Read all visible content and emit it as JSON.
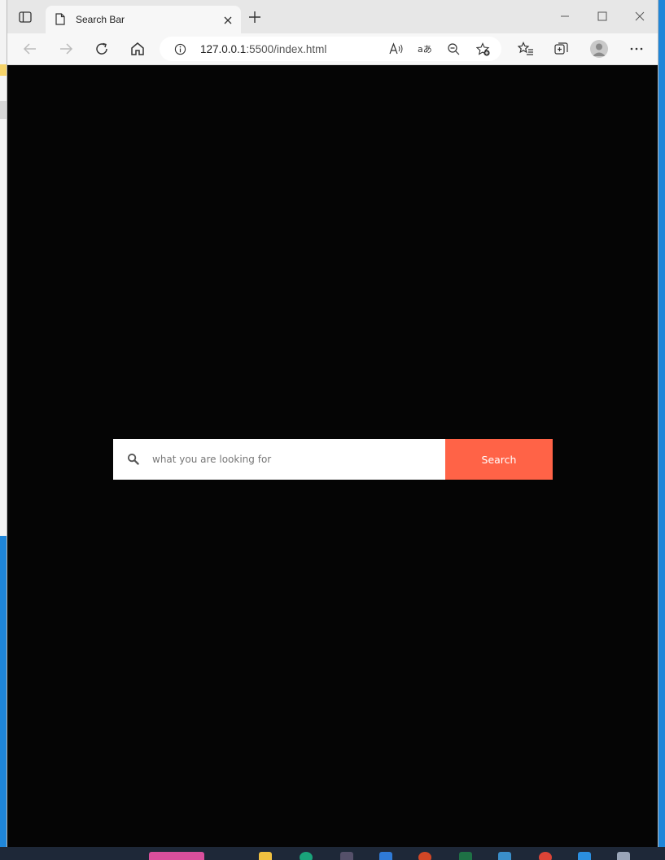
{
  "browser": {
    "tab": {
      "title": "Search Bar"
    },
    "address": {
      "host": "127.0.0.1",
      "rest": ":5500/index.html"
    }
  },
  "page": {
    "search": {
      "placeholder": "what you are looking for",
      "button_label": "Search"
    }
  },
  "colors": {
    "page_background": "#050505",
    "search_button": "#ff6347",
    "search_field": "#ffffff"
  },
  "icons": [
    "tab-actions-icon",
    "page-icon",
    "close-icon",
    "new-tab-icon",
    "minimize-icon",
    "maximize-icon",
    "window-close-icon",
    "back-icon",
    "forward-icon",
    "refresh-icon",
    "home-icon",
    "site-info-icon",
    "read-aloud-icon",
    "translate-icon",
    "zoom-out-icon",
    "add-favorite-icon",
    "favorites-icon",
    "collections-icon",
    "profile-avatar",
    "more-icon",
    "search-icon"
  ]
}
